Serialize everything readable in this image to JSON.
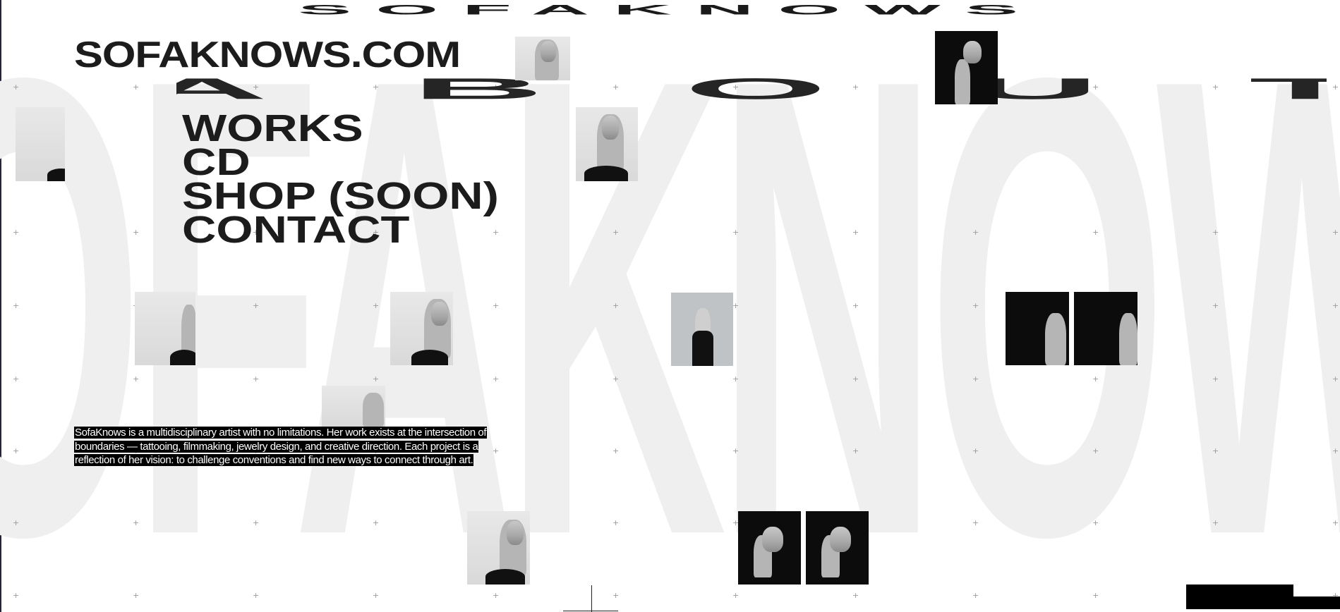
{
  "header": {
    "marquee_text": "SOFAKNOWS",
    "logo_text": "SOFAKNOWS.COM"
  },
  "background_word": "SOFAKNOWS",
  "about_letters": [
    "A",
    "B",
    "O",
    "U",
    "T"
  ],
  "nav": {
    "items": [
      {
        "label": "WORKS"
      },
      {
        "label": "CD"
      },
      {
        "label": "SHOP (SOON)"
      },
      {
        "label": "CONTACT"
      }
    ]
  },
  "bio": {
    "text": "SofaKnows is a multidisciplinary artist with no limitations. Her work exists at the intersection of boundaries — tattooing, filmmaking, jewelry design, and creative direction. Each project is a reflection of her vision: to challenge conventions and find new ways to connect through art."
  },
  "colors": {
    "text": "#1c1c1c",
    "bg_word": "#efefef",
    "bio_bg": "#000000",
    "bio_text": "#ffffff"
  },
  "icons": {
    "grid_marker": "plus-icon"
  }
}
